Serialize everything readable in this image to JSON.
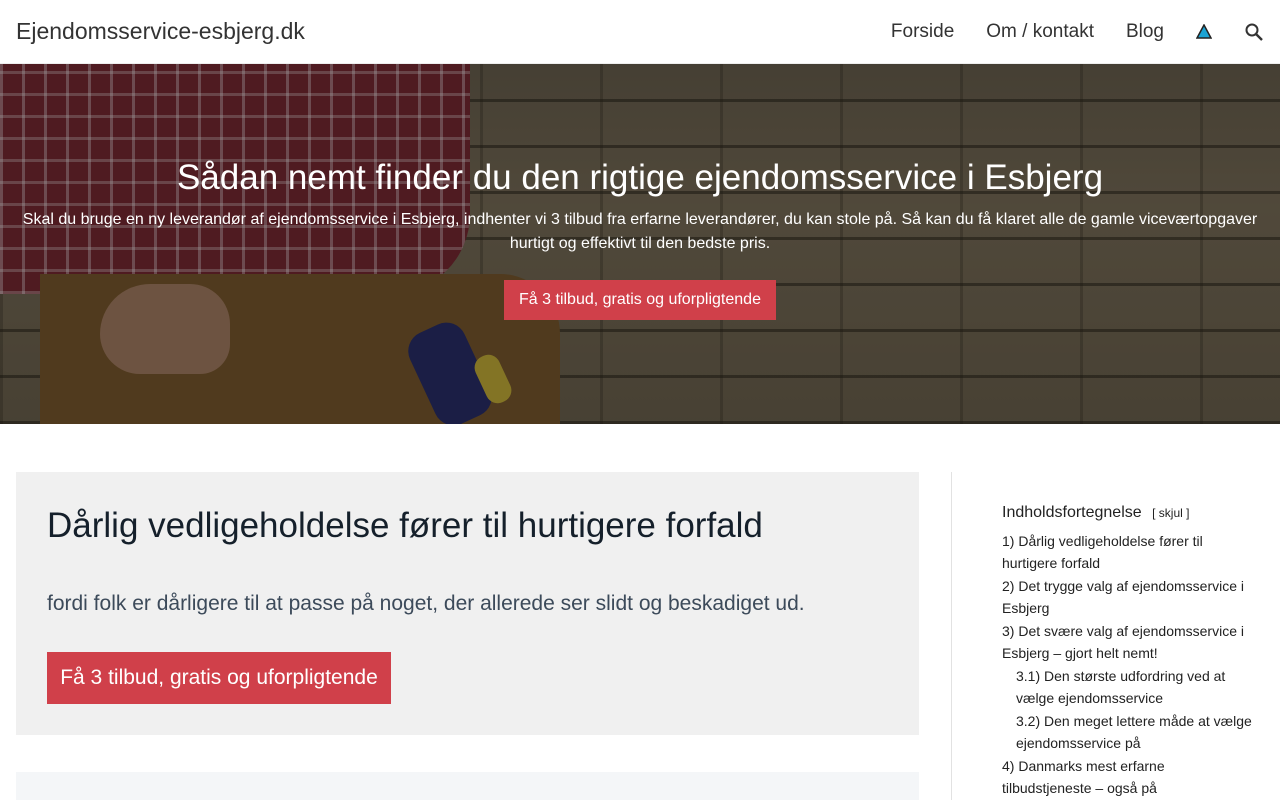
{
  "header": {
    "site_title": "Ejendomsservice-esbjerg.dk",
    "nav": [
      {
        "label": "Forside"
      },
      {
        "label": "Om / kontakt"
      },
      {
        "label": "Blog"
      }
    ],
    "icons": {
      "warning": "warning-triangle-icon",
      "search": "search-icon"
    },
    "accent_color": "#1aa3d4"
  },
  "hero": {
    "title": "Sådan nemt finder du den rigtige ejendomsservice i Esbjerg",
    "text": "Skal du bruge en ny leverandør af ejendomsservice i Esbjerg, indhenter vi 3 tilbud fra erfarne leverandører, du kan stole på. Så kan du få klaret alle de gamle viceværtopgaver hurtigt og effektivt til den bedste pris.",
    "button": "Få 3 tilbud, gratis og uforpligtende",
    "button_color": "#d0404a"
  },
  "card": {
    "heading": "Dårlig vedligeholdelse fører til hurtigere forfald",
    "text": "fordi folk er dårligere til at passe på noget, der allerede ser slidt og beskadiget ud.",
    "button": "Få 3 tilbud, gratis og uforpligtende"
  },
  "toc": {
    "title": "Indholdsfortegnelse",
    "hide": "[ skjul ]",
    "items": [
      {
        "label": "1) Dårlig vedligeholdelse fører til hurtigere forfald"
      },
      {
        "label": "2) Det trygge valg af ejendomsservice i Esbjerg"
      },
      {
        "label": "3) Det svære valg af ejendomsservice i Esbjerg – gjort helt nemt!"
      },
      {
        "label": "3.1) Den største udfordring ved at vælge ejendomsservice"
      },
      {
        "label": "3.2) Den meget lettere måde at vælge ejendomsservice på"
      },
      {
        "label": "4) Danmarks mest erfarne tilbudstjeneste – også på"
      }
    ]
  }
}
